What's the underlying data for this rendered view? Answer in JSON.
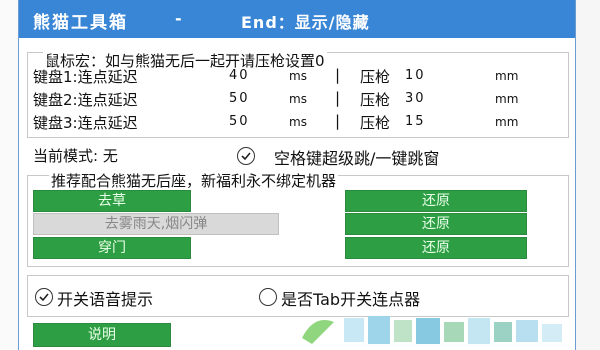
{
  "window": {
    "title": "熊猫工具箱",
    "separator": "-",
    "hotkey": "End：显示/隐藏"
  },
  "macro_hint": "鼠标宏：如与熊猫无后一起开请压枪设置0",
  "keys": [
    {
      "label": "键盘1:连点延迟",
      "delay": "40",
      "delay_unit": "ms",
      "sep": "|",
      "recoil_label": "压枪",
      "recoil": "10",
      "recoil_unit": "mm"
    },
    {
      "label": "键盘2:连点延迟",
      "delay": "50",
      "delay_unit": "ms",
      "sep": "|",
      "recoil_label": "压枪",
      "recoil": "30",
      "recoil_unit": "mm"
    },
    {
      "label": "键盘3:连点延迟",
      "delay": "50",
      "delay_unit": "ms",
      "sep": "|",
      "recoil_label": "压枪",
      "recoil": "15",
      "recoil_unit": "mm"
    }
  ],
  "mode": {
    "label": "当前模式: 无",
    "jump_option": "空格键超级跳/一键跳窗",
    "jump_checked": true
  },
  "recommend_text": "推荐配合熊猫无后座，新福利永不绑定机器",
  "actions": [
    {
      "left": "去草",
      "left_enabled": true,
      "right": "还原"
    },
    {
      "left": "去雾雨天,烟闪弹",
      "left_enabled": false,
      "right": "还原"
    },
    {
      "left": "穿门",
      "left_enabled": true,
      "right": "还原"
    }
  ],
  "options": {
    "voice": "开关语音提示",
    "voice_checked": true,
    "tab_toggle": "是否Tab开关连点器",
    "tab_checked": false
  },
  "help_button": "说明",
  "colors": {
    "titlebar": "#3a86d6",
    "button_green": "#2e9e45",
    "button_disabled": "#d9d9d9"
  }
}
